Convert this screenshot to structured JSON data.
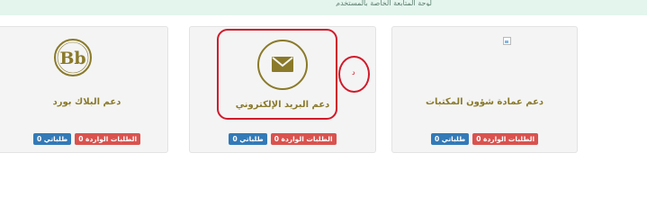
{
  "banner": {
    "text": "لوحة المتابعة الخاصة بالمستخدم"
  },
  "cards": [
    {
      "title": "دعم البلاك بورد",
      "icon": "blackboard-logo-icon",
      "logo_text": "Bb",
      "badges": {
        "incoming_label": "الطلبات الواردة 0",
        "mine_label": "طلباتي 0"
      }
    },
    {
      "title": "دعم البريد الإلكتروني",
      "icon": "envelope-icon",
      "badges": {
        "incoming_label": "الطلبات الواردة 0",
        "mine_label": "طلباتي 0"
      }
    },
    {
      "title": "دعم عمادة شؤون المكتبات",
      "icon": "broken-image-icon",
      "badges": {
        "incoming_label": "الطلبات الواردة 0",
        "mine_label": "طلباتي 0"
      }
    }
  ],
  "annotation": {
    "mark": "د"
  },
  "colors": {
    "banner_bg": "#e4f5ee",
    "card_bg": "#f4f4f4",
    "title_color": "#8a7a2a",
    "badge_red": "#d9534f",
    "badge_blue": "#337ab7",
    "annotation_red": "#d11a2a"
  }
}
